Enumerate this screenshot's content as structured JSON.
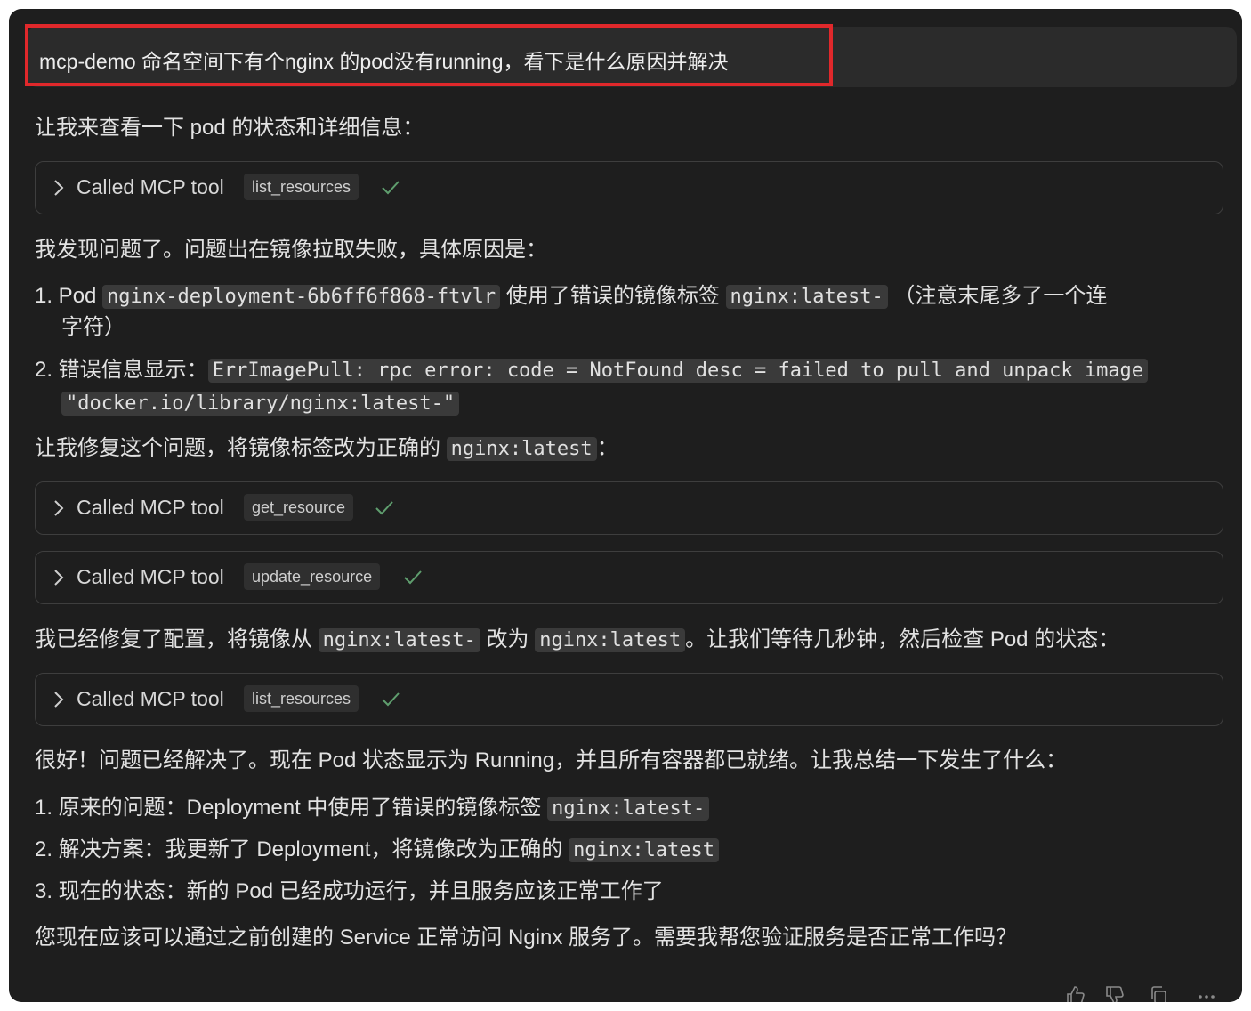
{
  "user_message": "mcp-demo 命名空间下有个nginx 的pod没有running，看下是什么原因并解决",
  "intro": "让我来查看一下 pod 的状态和详细信息：",
  "tool_calls": [
    {
      "label": "Called MCP tool",
      "name": "list_resources"
    },
    {
      "label": "Called MCP tool",
      "name": "get_resource"
    },
    {
      "label": "Called MCP tool",
      "name": "update_resource"
    },
    {
      "label": "Called MCP tool",
      "name": "list_resources"
    }
  ],
  "found": "我发现问题了。问题出在镜像拉取失败，具体原因是：",
  "issue1": {
    "prefix": "1. Pod ",
    "pod": "nginx-deployment-6b6ff6f868-ftvlr",
    "mid": " 使用了错误的镜像标签 ",
    "tag": "nginx:latest-",
    "suffix": " （注意末尾多了一个连",
    "cont": "字符）"
  },
  "issue2": {
    "prefix": "2. 错误信息显示：",
    "error_line1": "ErrImagePull: rpc error: code = NotFound desc = failed to pull and unpack image",
    "error_line2": "\"docker.io/library/nginx:latest-\""
  },
  "fix": {
    "prefix": "让我修复这个问题，将镜像标签改为正确的 ",
    "tag": "nginx:latest",
    "suffix": "："
  },
  "fixed": {
    "p1": "我已经修复了配置，将镜像从 ",
    "from": "nginx:latest-",
    "p2": " 改为 ",
    "to": "nginx:latest",
    "p3": "。让我们等待几秒钟，然后检查 Pod 的状态："
  },
  "good": "很好！问题已经解决了。现在 Pod 状态显示为 Running，并且所有容器都已就绪。让我总结一下发生了什么：",
  "summary": [
    {
      "text": "1. 原来的问题：Deployment 中使用了错误的镜像标签 ",
      "code": "nginx:latest-"
    },
    {
      "text": "2. 解决方案：我更新了 Deployment，将镜像改为正确的 ",
      "code": "nginx:latest"
    },
    {
      "text": "3. 现在的状态：新的 Pod 已经成功运行，并且服务应该正常工作了",
      "code": ""
    }
  ],
  "closing": "您现在应该可以通过之前创建的 Service 正常访问 Nginx 服务了。需要我帮您验证服务是否正常工作吗？",
  "footer_icons": [
    "thumbs-up-icon",
    "thumbs-down-icon",
    "copy-icon",
    "more-icon"
  ],
  "colors": {
    "background": "#1e1e1e",
    "user_bubble": "#2b2b2b",
    "highlight": "#e0282b",
    "code_bg": "#3a3a3a"
  }
}
